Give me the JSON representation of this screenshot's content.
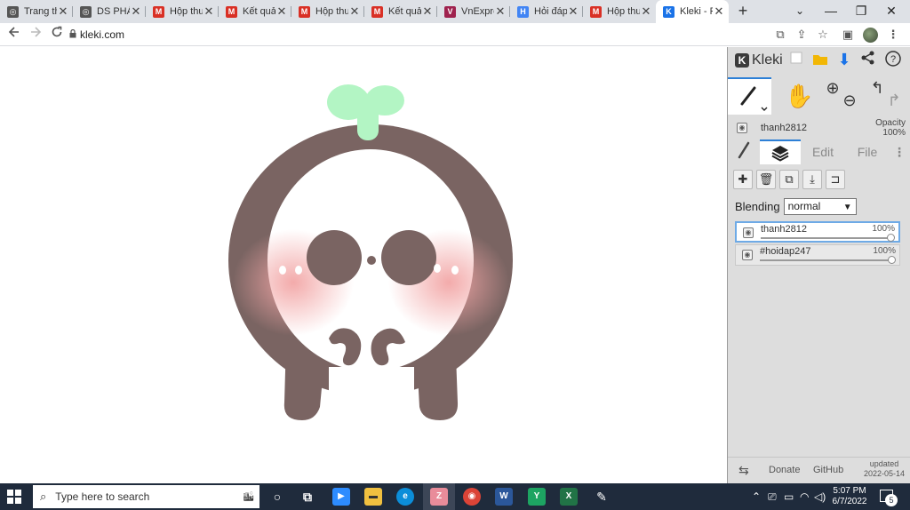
{
  "browser": {
    "tabs": [
      {
        "title": "Trang th",
        "icon": "globe-icon",
        "favicon_color": "#555555",
        "favicon_glyph": "◎"
      },
      {
        "title": "DS PHÁI",
        "icon": "globe-icon",
        "favicon_color": "#555555",
        "favicon_glyph": "◎"
      },
      {
        "title": "Hộp thư",
        "icon": "gmail-icon",
        "favicon_color": "#d93025",
        "favicon_glyph": "M"
      },
      {
        "title": "Kết quả",
        "icon": "gmail-icon",
        "favicon_color": "#d93025",
        "favicon_glyph": "M"
      },
      {
        "title": "Hộp thư",
        "icon": "gmail-icon",
        "favicon_color": "#d93025",
        "favicon_glyph": "M"
      },
      {
        "title": "Kết quả",
        "icon": "gmail-icon",
        "favicon_color": "#d93025",
        "favicon_glyph": "M"
      },
      {
        "title": "VnExpre",
        "icon": "vnexpress-icon",
        "favicon_color": "#9f224e",
        "favicon_glyph": "V"
      },
      {
        "title": "Hỏi đáp",
        "icon": "hoidap-icon",
        "favicon_color": "#4285f4",
        "favicon_glyph": "H"
      },
      {
        "title": "Hộp thư",
        "icon": "gmail-icon",
        "favicon_color": "#d93025",
        "favicon_glyph": "M"
      },
      {
        "title": "Kleki - F",
        "icon": "kleki-icon",
        "favicon_color": "#1a73e8",
        "favicon_glyph": "K",
        "active": true
      }
    ],
    "close_glyph": "✕",
    "new_tab_glyph": "+",
    "window_controls": {
      "minimize": "—",
      "maximize": "❐",
      "close": "✕",
      "tab_search": "⌄"
    },
    "url": "kleki.com"
  },
  "kleki": {
    "logo_text": "Kleki",
    "author": "thanh2812",
    "opacity_label": "Opacity",
    "opacity_value": "100%",
    "tabs": {
      "edit": "Edit",
      "file": "File"
    },
    "blending_label": "Blending",
    "blending_value": "normal",
    "layers": [
      {
        "name": "thanh2812",
        "opacity": "100%",
        "opacity_fraction": 1.0,
        "selected": true
      },
      {
        "name": "#hoidap247",
        "opacity": "100%",
        "opacity_fraction": 1.0,
        "selected": false
      }
    ],
    "footer": {
      "donate": "Donate",
      "github": "GitHub",
      "updated_label": "updated",
      "updated_date": "2022-05-14"
    }
  },
  "canvas": {
    "colors": {
      "body": "#7a6462",
      "face": "#ffffff",
      "blush": "#f2a6a6",
      "sprout": "#b3f5c4",
      "eye_dot": "#ffffff"
    }
  },
  "taskbar": {
    "search_placeholder": "Type here to search",
    "time": "5:07 PM",
    "date": "6/7/2022",
    "notification_count": "5"
  }
}
